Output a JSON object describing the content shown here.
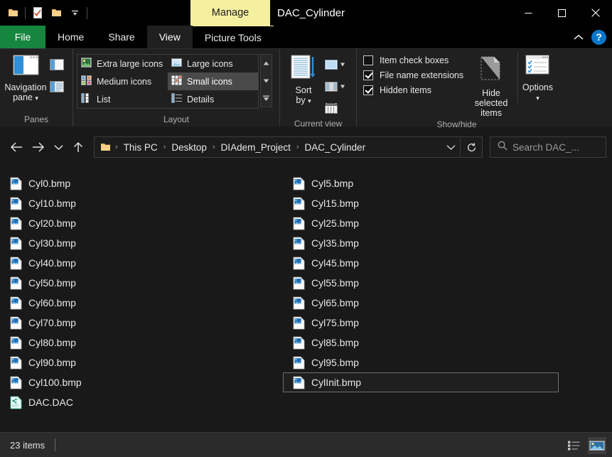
{
  "window": {
    "title": "DAC_Cylinder",
    "contextual_tab_banner": "Manage",
    "quick_access": [
      {
        "name": "folder-icon",
        "label": "Folder"
      },
      {
        "name": "properties-icon",
        "label": "Properties"
      },
      {
        "name": "new-folder-icon",
        "label": "New folder"
      },
      {
        "name": "customize-qat-dropdown-icon",
        "label": "Customize Quick Access Toolbar"
      }
    ],
    "controls": {
      "minimize": "—",
      "maximize": "☐",
      "close": "✕"
    }
  },
  "tabs": [
    {
      "label": "File",
      "kind": "file"
    },
    {
      "label": "Home",
      "kind": "normal"
    },
    {
      "label": "Share",
      "kind": "normal"
    },
    {
      "label": "View",
      "kind": "active"
    },
    {
      "label": "Picture Tools",
      "kind": "contextual"
    }
  ],
  "tabstrip_right": {
    "collapse_ribbon": "⌃",
    "help": "?"
  },
  "ribbon": {
    "groups": [
      {
        "name": "panes",
        "label": "Panes",
        "big_button": "Navigation\npane",
        "big_button_line1": "Navigation",
        "big_button_line2": "pane",
        "small_buttons": [
          "preview-pane-icon",
          "details-pane-icon"
        ]
      },
      {
        "name": "layout",
        "label": "Layout",
        "gallery": [
          {
            "label": "Extra large icons",
            "selected": false
          },
          {
            "label": "Large icons",
            "selected": false
          },
          {
            "label": "Medium icons",
            "selected": false
          },
          {
            "label": "Small icons",
            "selected": true
          },
          {
            "label": "List",
            "selected": false
          },
          {
            "label": "Details",
            "selected": false
          }
        ]
      },
      {
        "name": "current-view",
        "label": "Current view",
        "sort_by_line1": "Sort",
        "sort_by_line2": "by",
        "small_buttons": [
          "add-columns-icon",
          "group-by-icon",
          "size-all-columns-icon"
        ]
      },
      {
        "name": "show-hide",
        "label": "Show/hide",
        "checkboxes": [
          {
            "label": "Item check boxes",
            "checked": false
          },
          {
            "label": "File name extensions",
            "checked": true
          },
          {
            "label": "Hidden items",
            "checked": true
          }
        ],
        "hide_selected_line1": "Hide selected",
        "hide_selected_line2": "items",
        "options_label": "Options"
      }
    ]
  },
  "address_bar": {
    "back": "←",
    "forward": "→",
    "recent": "⌄",
    "up": "↑",
    "breadcrumbs": [
      "This PC",
      "Desktop",
      "DIAdem_Project",
      "DAC_Cylinder"
    ],
    "separator": "›",
    "dropdown": "⌄",
    "refresh": "↻",
    "search_placeholder": "Search DAC_..."
  },
  "files": {
    "column1": [
      {
        "name": "Cyl0.bmp",
        "type": "bmp"
      },
      {
        "name": "Cyl10.bmp",
        "type": "bmp"
      },
      {
        "name": "Cyl20.bmp",
        "type": "bmp"
      },
      {
        "name": "Cyl30.bmp",
        "type": "bmp"
      },
      {
        "name": "Cyl40.bmp",
        "type": "bmp"
      },
      {
        "name": "Cyl50.bmp",
        "type": "bmp"
      },
      {
        "name": "Cyl60.bmp",
        "type": "bmp"
      },
      {
        "name": "Cyl70.bmp",
        "type": "bmp"
      },
      {
        "name": "Cyl80.bmp",
        "type": "bmp"
      },
      {
        "name": "Cyl90.bmp",
        "type": "bmp"
      },
      {
        "name": "Cyl100.bmp",
        "type": "bmp"
      },
      {
        "name": "DAC.DAC",
        "type": "dac"
      }
    ],
    "column2": [
      {
        "name": "Cyl5.bmp",
        "type": "bmp"
      },
      {
        "name": "Cyl15.bmp",
        "type": "bmp"
      },
      {
        "name": "Cyl25.bmp",
        "type": "bmp"
      },
      {
        "name": "Cyl35.bmp",
        "type": "bmp"
      },
      {
        "name": "Cyl45.bmp",
        "type": "bmp"
      },
      {
        "name": "Cyl55.bmp",
        "type": "bmp"
      },
      {
        "name": "Cyl65.bmp",
        "type": "bmp"
      },
      {
        "name": "Cyl75.bmp",
        "type": "bmp"
      },
      {
        "name": "Cyl85.bmp",
        "type": "bmp"
      },
      {
        "name": "Cyl95.bmp",
        "type": "bmp"
      },
      {
        "name": "CylInit.bmp",
        "type": "bmp",
        "focused": true
      }
    ]
  },
  "status_bar": {
    "item_count": "23 items",
    "view_buttons": [
      {
        "name": "details-view-button",
        "active": false
      },
      {
        "name": "large-icons-view-button",
        "active": true
      }
    ]
  },
  "colors": {
    "file_tab_green": "#16863f",
    "contextual_yellow": "#f5f0a0",
    "help_blue": "#0a76c8",
    "background": "#191919",
    "ribbon": "#202020",
    "status_bar": "#2b2b2b"
  }
}
